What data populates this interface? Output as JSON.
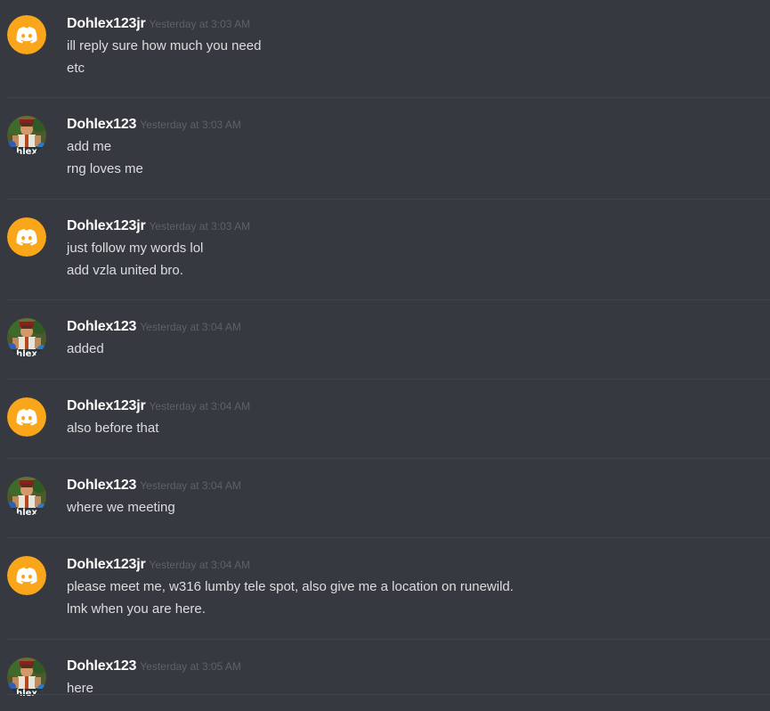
{
  "messages": [
    {
      "author": "Dohlex123jr",
      "avatar": "discord-default-orange-avatar",
      "timestamp": "Yesterday at 3:03 AM",
      "lines": [
        "ill reply sure how much you need",
        "etc"
      ]
    },
    {
      "author": "Dohlex123",
      "avatar": "runescape-character-avatar",
      "timestamp": "Yesterday at 3:03 AM",
      "lines": [
        "add me",
        "rng loves me"
      ]
    },
    {
      "author": "Dohlex123jr",
      "avatar": "discord-default-orange-avatar",
      "timestamp": "Yesterday at 3:03 AM",
      "lines": [
        "just follow my words lol",
        "add vzla united bro."
      ]
    },
    {
      "author": "Dohlex123",
      "avatar": "runescape-character-avatar",
      "timestamp": "Yesterday at 3:04 AM",
      "lines": [
        "added"
      ]
    },
    {
      "author": "Dohlex123jr",
      "avatar": "discord-default-orange-avatar",
      "timestamp": "Yesterday at 3:04 AM",
      "lines": [
        "also before that"
      ]
    },
    {
      "author": "Dohlex123",
      "avatar": "runescape-character-avatar",
      "timestamp": "Yesterday at 3:04 AM",
      "lines": [
        "where we meeting"
      ]
    },
    {
      "author": "Dohlex123jr",
      "avatar": "discord-default-orange-avatar",
      "timestamp": "Yesterday at 3:04 AM",
      "lines": [
        "please  meet me, w316 lumby tele spot, also give me a location on runewild.",
        "lmk when you are here."
      ]
    },
    {
      "author": "Dohlex123",
      "avatar": "runescape-character-avatar",
      "timestamp": "Yesterday at 3:05 AM",
      "lines": [
        "here"
      ]
    }
  ],
  "colors": {
    "background": "#36393f",
    "username": "#ffffff",
    "message_text": "#dcddde",
    "timestamp": "#5e6167",
    "divider": "#40434a",
    "default_avatar": "#faa61a"
  }
}
